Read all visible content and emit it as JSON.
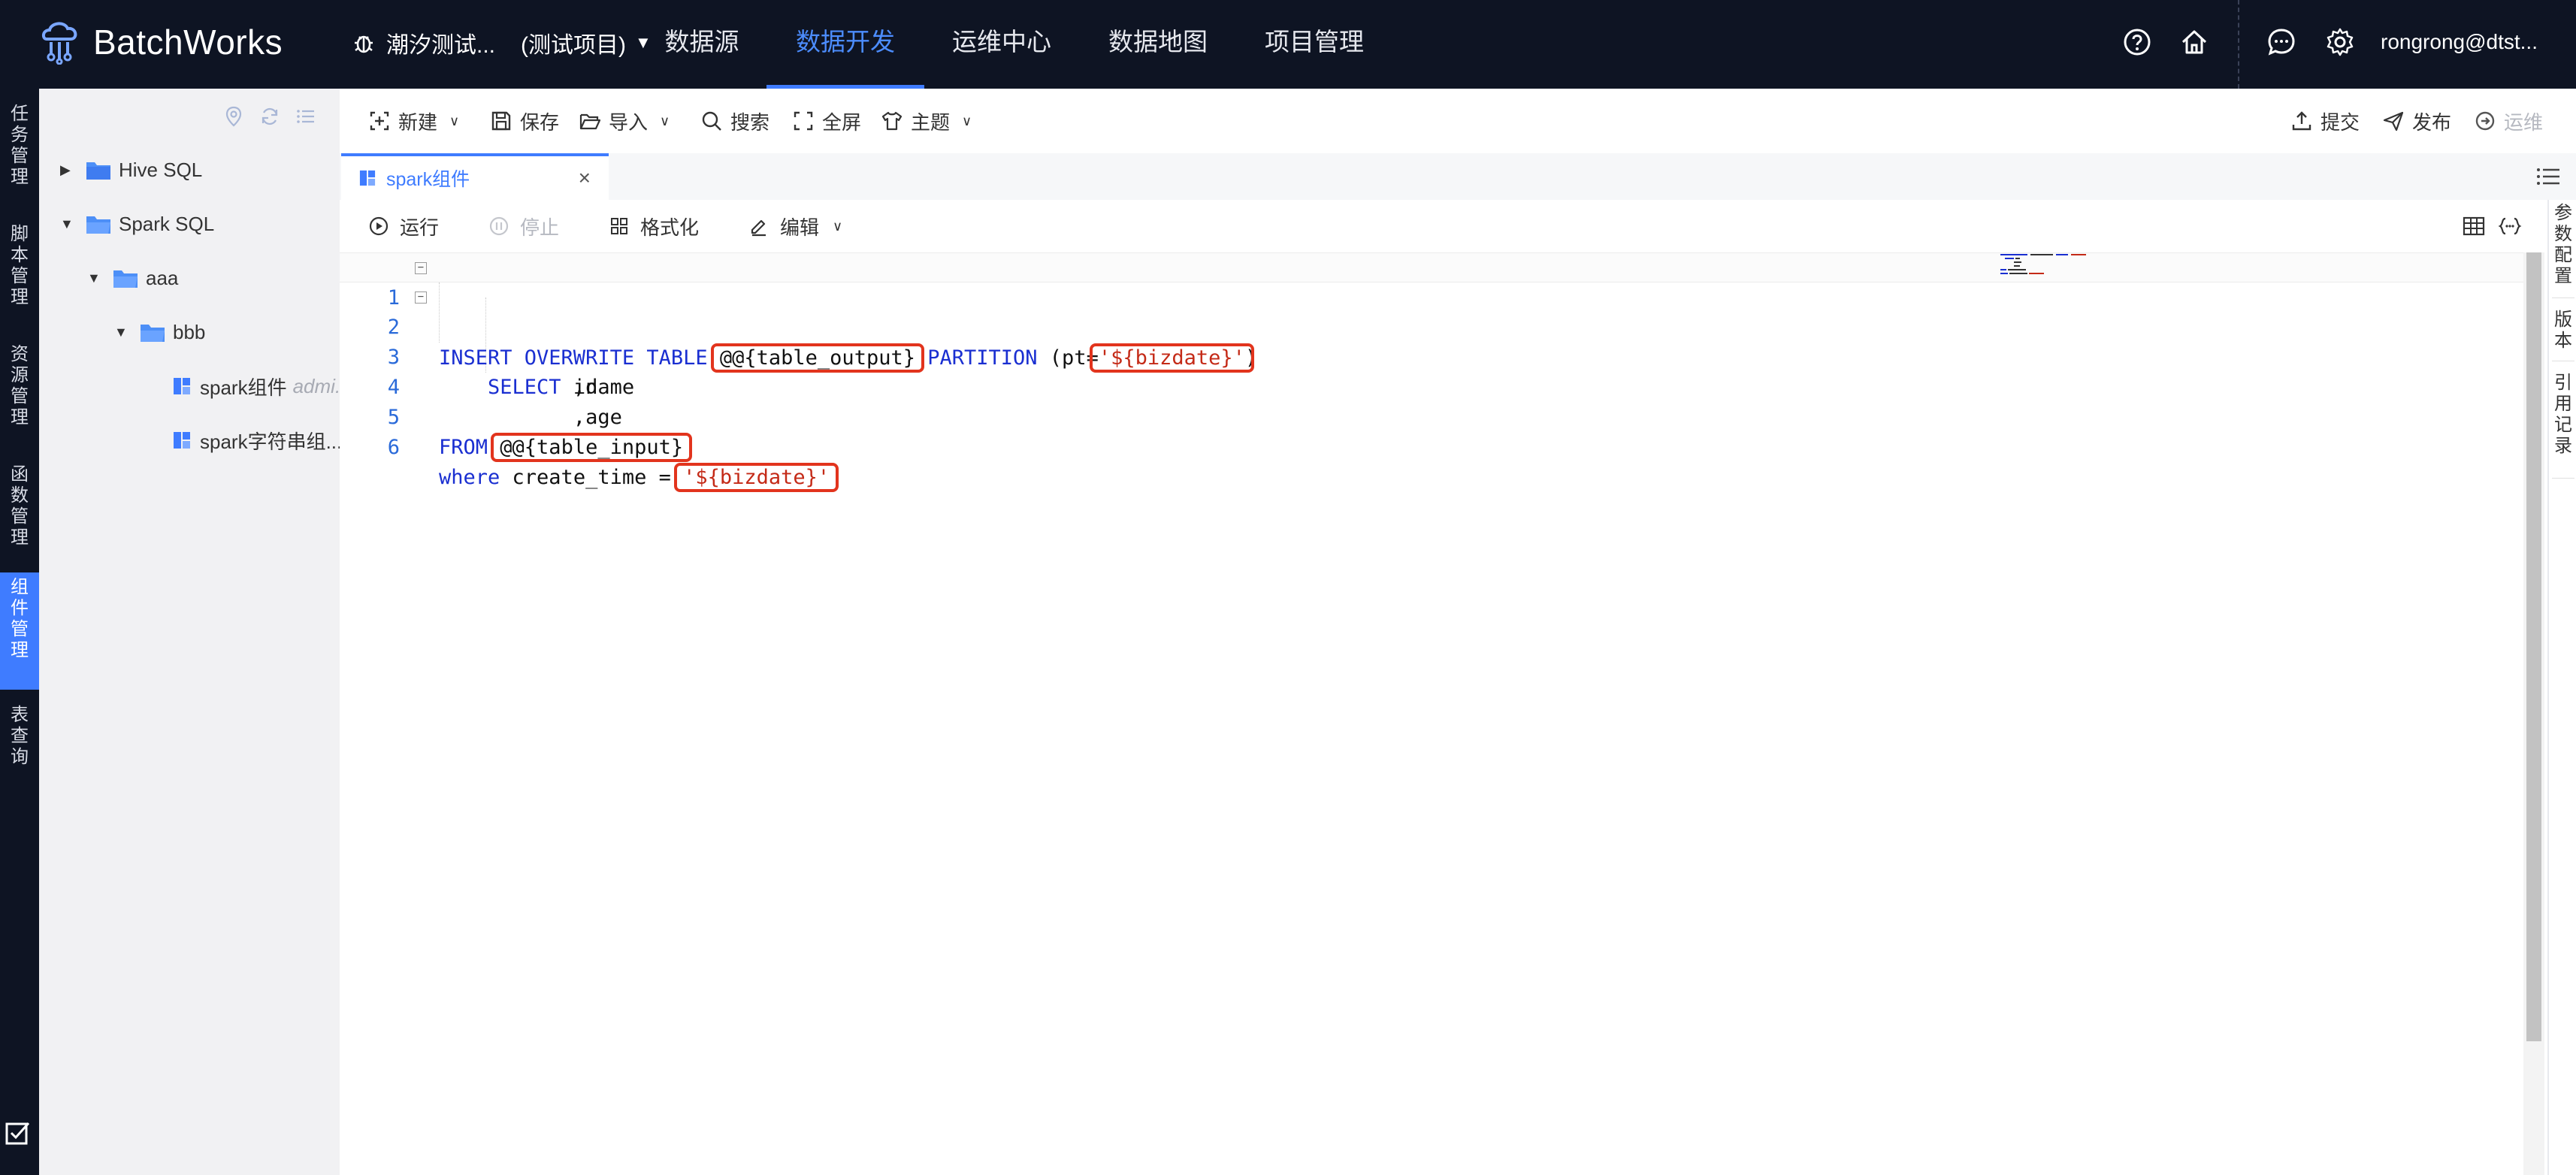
{
  "app": {
    "name": "BatchWorks",
    "project_name": "潮汐测试...",
    "project_tag": "(测试项目)",
    "user": "rongrong@dtst..."
  },
  "nav": [
    {
      "label": "数据源",
      "active": false
    },
    {
      "label": "数据开发",
      "active": true
    },
    {
      "label": "运维中心",
      "active": false
    },
    {
      "label": "数据地图",
      "active": false
    },
    {
      "label": "项目管理",
      "active": false
    }
  ],
  "rail": [
    {
      "label": "任务管理",
      "chars": [
        "任",
        "务",
        "管",
        "理"
      ],
      "active": false
    },
    {
      "label": "脚本管理",
      "chars": [
        "脚",
        "本",
        "管",
        "理"
      ],
      "active": false
    },
    {
      "label": "资源管理",
      "chars": [
        "资",
        "源",
        "管",
        "理"
      ],
      "active": false
    },
    {
      "label": "函数管理",
      "chars": [
        "函",
        "数",
        "管",
        "理"
      ],
      "active": false
    },
    {
      "label": "组件管理",
      "chars": [
        "组",
        "件",
        "管",
        "理"
      ],
      "active": true
    },
    {
      "label": "表查询",
      "chars": [
        "表",
        "查",
        "询"
      ],
      "active": false
    }
  ],
  "tree": {
    "items": [
      {
        "label": "Hive SQL",
        "type": "folder",
        "expanded": false
      },
      {
        "label": "Spark SQL",
        "type": "folder",
        "expanded": true
      },
      {
        "label": "aaa",
        "type": "folder",
        "expanded": true
      },
      {
        "label": "bbb",
        "type": "folder",
        "expanded": true
      },
      {
        "label": "spark组件",
        "owner": "admi...",
        "type": "component",
        "selected": true
      },
      {
        "label": "spark字符串组...",
        "type": "component",
        "selected": false
      }
    ]
  },
  "toolbar": {
    "new": "新建",
    "save": "保存",
    "import": "导入",
    "search": "搜索",
    "fullscreen": "全屏",
    "theme": "主题",
    "submit": "提交",
    "publish": "发布",
    "ops": "运维"
  },
  "tabs": [
    {
      "label": "spark组件",
      "active": true
    }
  ],
  "editor_actions": {
    "run": "运行",
    "stop": "停止",
    "format": "格式化",
    "edit": "编辑"
  },
  "code": {
    "line_numbers": [
      "1",
      "2",
      "3",
      "4",
      "5",
      "6"
    ],
    "lines": [
      [
        {
          "t": "INSERT OVERWRITE TABLE",
          "c": "kw"
        },
        {
          "t": " @@{table_output} ",
          "c": ""
        },
        {
          "t": "PARTITION",
          "c": "kw"
        },
        {
          "t": " (pt=",
          "c": ""
        },
        {
          "t": "'${bizdate}'",
          "c": "str"
        },
        {
          "t": ")",
          "c": ""
        }
      ],
      [
        {
          "t": "    ",
          "c": ""
        },
        {
          "t": "SELECT",
          "c": "kw"
        },
        {
          "t": " id",
          "c": ""
        }
      ],
      [
        {
          "t": "           ,name",
          "c": ""
        }
      ],
      [
        {
          "t": "           ,age",
          "c": ""
        }
      ],
      [
        {
          "t": "FROM",
          "c": "kw"
        },
        {
          "t": " @@{table_input}",
          "c": ""
        }
      ],
      [
        {
          "t": "where",
          "c": "kw"
        },
        {
          "t": " create_time = ",
          "c": ""
        },
        {
          "t": "'${bizdate}'",
          "c": "str"
        }
      ]
    ]
  },
  "right_panel": [
    {
      "label": "参数配置",
      "chars": [
        "参",
        "数",
        "配",
        "置"
      ]
    },
    {
      "label": "版本",
      "chars": [
        "版",
        "本"
      ]
    },
    {
      "label": "引用记录",
      "chars": [
        "引",
        "用",
        "记",
        "录"
      ]
    }
  ],
  "colors": {
    "topbar": "#0e1423",
    "accent": "#3f7cff",
    "keyword": "#1a2fd1",
    "string": "#c42a17",
    "highlight_box": "#e2341d"
  }
}
